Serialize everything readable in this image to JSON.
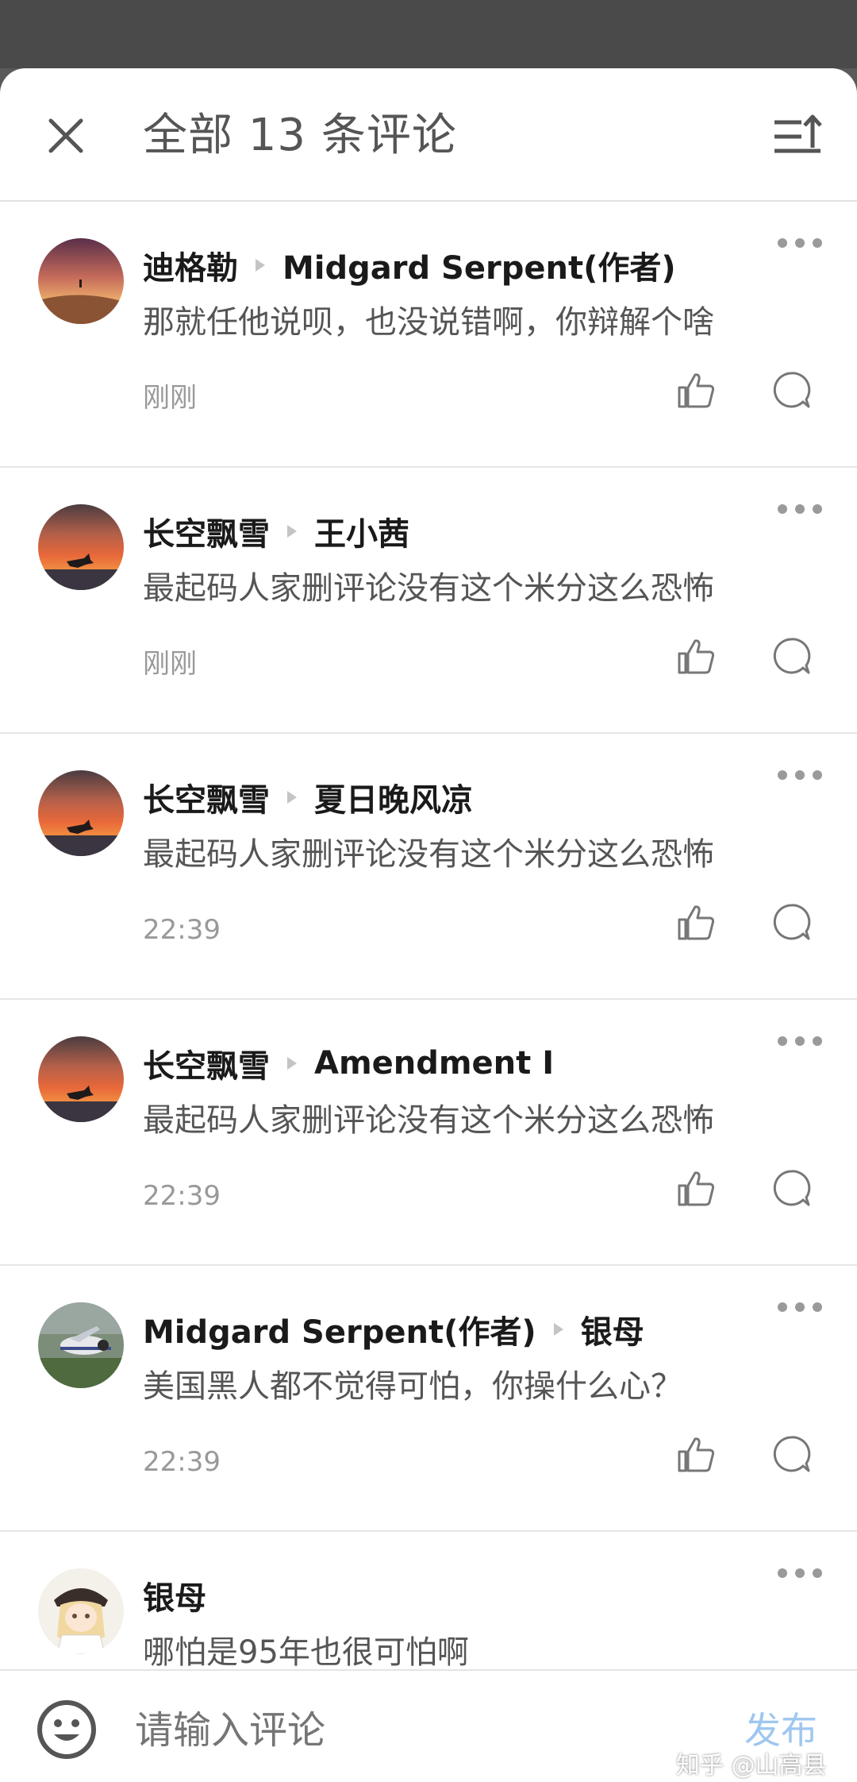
{
  "header": {
    "title": "全部 13 条评论"
  },
  "comments": [
    {
      "author": "迪格勒",
      "reply_to": "Midgard Serpent(作者)",
      "text": "那就任他说呗，也没说错啊，你辩解个啥",
      "time": "刚刚",
      "avatar": "desert-sunset"
    },
    {
      "author": "长空飘雪",
      "reply_to": "王小茜",
      "text": "最起码人家删评论没有这个米分这么恐怖",
      "time": "刚刚",
      "avatar": "sunset-horse"
    },
    {
      "author": "长空飘雪",
      "reply_to": "夏日晚风凉",
      "text": "最起码人家删评论没有这个米分这么恐怖",
      "time": "22:39",
      "avatar": "sunset-horse"
    },
    {
      "author": "长空飘雪",
      "reply_to": "Amendment I",
      "text": "最起码人家删评论没有这个米分这么恐怖",
      "time": "22:39",
      "avatar": "sunset-horse"
    },
    {
      "author": "Midgard Serpent(作者)",
      "reply_to": "银母",
      "text": "美国黑人都不觉得可怕，你操什么心？",
      "time": "22:39",
      "avatar": "airplane"
    },
    {
      "author": "银母",
      "reply_to": "",
      "text": "哪怕是95年也很可怕啊",
      "time": "",
      "avatar": "anime-girl"
    }
  ],
  "bottom_bar": {
    "placeholder": "请输入评论",
    "publish_label": "发布",
    "watermark": "知乎 @山高县"
  },
  "colors": {
    "accent_disabled": "#9ec7f0",
    "text_primary": "#1a1a1a",
    "text_secondary": "#555555",
    "text_muted": "#999999"
  }
}
